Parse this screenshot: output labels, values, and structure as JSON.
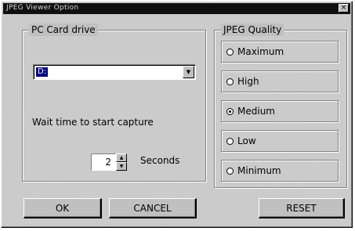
{
  "window": {
    "title": "JPEG Viewer Option",
    "close_glyph": "×"
  },
  "pc_card": {
    "group_label": "PC Card drive",
    "drive_value": "D:",
    "dropdown_glyph": "▼"
  },
  "capture": {
    "label": "Wait time to start capture",
    "value": "2",
    "unit": "Seconds",
    "up_glyph": "▲",
    "down_glyph": "▼"
  },
  "quality": {
    "group_label": "JPEG Quality",
    "selected": "Medium",
    "options": [
      {
        "label": "Maximum",
        "checked": false
      },
      {
        "label": "High",
        "checked": false
      },
      {
        "label": "Medium",
        "checked": true
      },
      {
        "label": "Low",
        "checked": false
      },
      {
        "label": "Minimum",
        "checked": false
      }
    ]
  },
  "buttons": {
    "ok": "OK",
    "cancel": "CANCEL",
    "reset": "RESET"
  }
}
